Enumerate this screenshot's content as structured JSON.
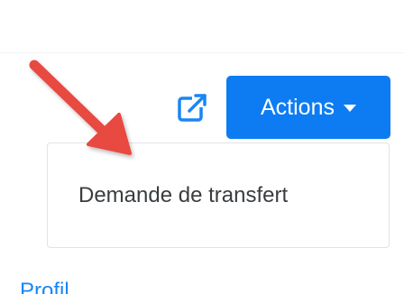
{
  "header": {
    "external_link_icon": "external-link-icon",
    "actions_label": "Actions",
    "caret_icon": "caret-down-icon"
  },
  "dropdown": {
    "items": [
      {
        "label": "Demande de transfert"
      }
    ]
  },
  "below": {
    "link_label": "Profil"
  },
  "annotation": {
    "icon": "red-arrow-icon",
    "color": "#e84a3f"
  },
  "colors": {
    "primary": "#0d7cf2",
    "link": "#1a86f5",
    "text": "#3a3d40",
    "border": "#dfe3e7"
  }
}
